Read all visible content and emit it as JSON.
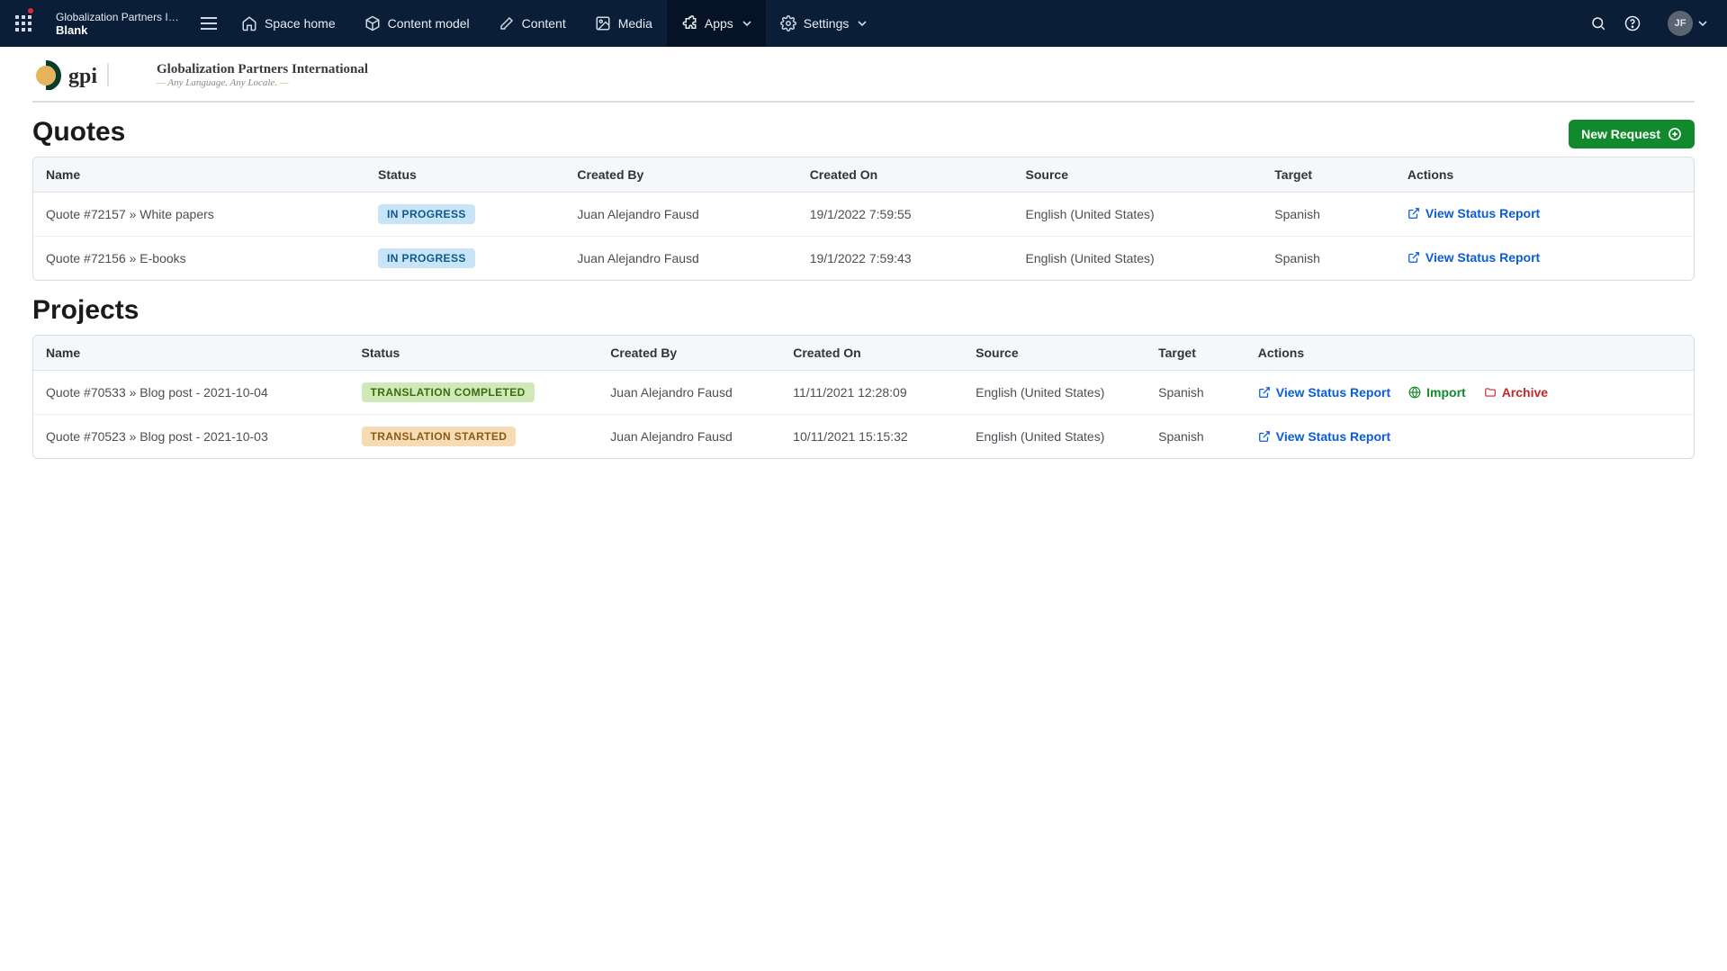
{
  "topbar": {
    "space_name": "Globalization Partners Interna...",
    "space_env": "Blank",
    "nav": {
      "space_home": "Space home",
      "content_model": "Content model",
      "content": "Content",
      "media": "Media",
      "apps": "Apps",
      "settings": "Settings"
    },
    "avatar_initials": "JF"
  },
  "brand": {
    "title": "Globalization Partners International",
    "tagline": "Any Language. Any Locale."
  },
  "buttons": {
    "new_request": "New Request"
  },
  "sections": {
    "quotes_title": "Quotes",
    "projects_title": "Projects"
  },
  "columns": {
    "name": "Name",
    "status": "Status",
    "created_by": "Created By",
    "created_on": "Created On",
    "source": "Source",
    "target": "Target",
    "actions": "Actions"
  },
  "quotes": [
    {
      "name": "Quote #72157 » White papers",
      "status": "IN PROGRESS",
      "status_class": "inprog",
      "created_by": "Juan Alejandro Fausd",
      "created_on": "19/1/2022 7:59:55",
      "source": "English (United States)",
      "target": "Spanish",
      "action_view": "View Status Report"
    },
    {
      "name": "Quote #72156 » E-books",
      "status": "IN PROGRESS",
      "status_class": "inprog",
      "created_by": "Juan Alejandro Fausd",
      "created_on": "19/1/2022 7:59:43",
      "source": "English (United States)",
      "target": "Spanish",
      "action_view": "View Status Report"
    }
  ],
  "projects": [
    {
      "name": "Quote #70533 » Blog post - 2021-10-04",
      "status": "TRANSLATION COMPLETED",
      "status_class": "complete",
      "created_by": "Juan Alejandro Fausd",
      "created_on": "11/11/2021 12:28:09",
      "source": "English (United States)",
      "target": "Spanish",
      "action_view": "View Status Report",
      "action_import": "Import",
      "action_archive": "Archive"
    },
    {
      "name": "Quote #70523 » Blog post - 2021-10-03",
      "status": "TRANSLATION STARTED",
      "status_class": "started",
      "created_by": "Juan Alejandro Fausd",
      "created_on": "10/11/2021 15:15:32",
      "source": "English (United States)",
      "target": "Spanish",
      "action_view": "View Status Report"
    }
  ]
}
